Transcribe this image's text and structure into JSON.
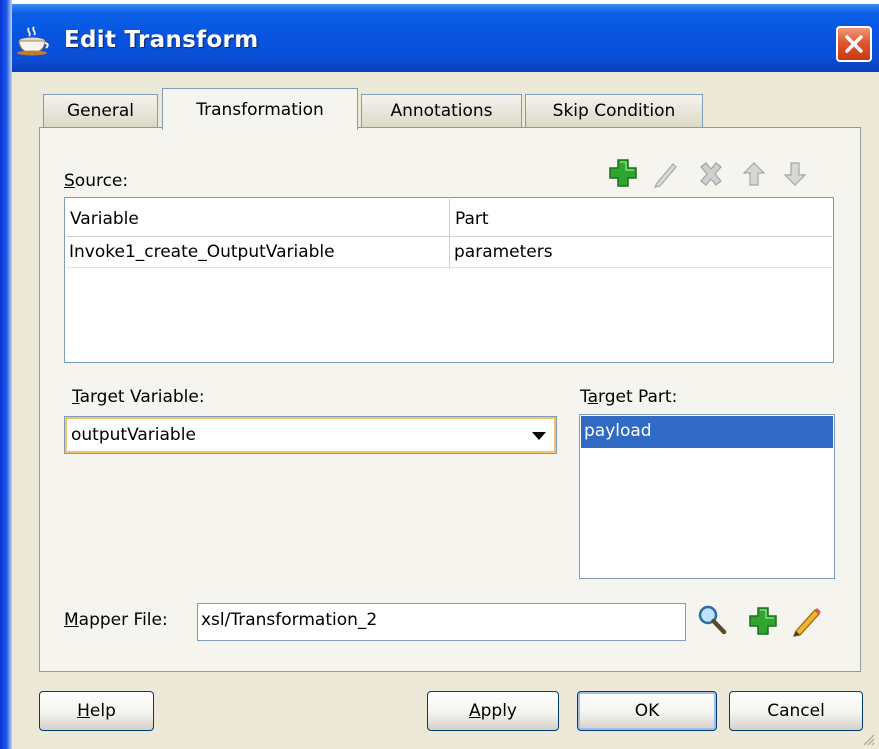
{
  "window": {
    "title": "Edit Transform",
    "icon": "coffee-cup-icon",
    "close_icon": "close-icon"
  },
  "tabs": [
    {
      "label": "General",
      "active": false
    },
    {
      "label": "Transformation",
      "active": true
    },
    {
      "label": "Annotations",
      "active": false
    },
    {
      "label": "Skip Condition",
      "active": false
    }
  ],
  "source": {
    "label_mnemonic": "S",
    "label_rest": "ource:",
    "toolbar": [
      "add-icon",
      "edit-icon",
      "delete-icon",
      "move-up-icon",
      "move-down-icon"
    ],
    "columns": [
      "Variable",
      "Part"
    ],
    "rows": [
      {
        "variable": "Invoke1_create_OutputVariable",
        "part": "parameters"
      }
    ]
  },
  "target_variable": {
    "label_mnemonic": "T",
    "label_rest": "arget Variable:",
    "value": "outputVariable"
  },
  "target_part": {
    "label_pre": "T",
    "label_mnemonic": "a",
    "label_rest": "rget Part:",
    "items": [
      "payload"
    ],
    "selected": "payload"
  },
  "mapper_file": {
    "label_mnemonic": "M",
    "label_rest": "apper File:",
    "value": "xsl/Transformation_2",
    "icons": [
      "search-icon",
      "add-icon",
      "edit-icon"
    ]
  },
  "buttons": {
    "help": {
      "mnemonic": "H",
      "rest": "elp"
    },
    "apply": {
      "mnemonic": "A",
      "rest": "pply"
    },
    "ok": "OK",
    "cancel": "Cancel"
  },
  "colors": {
    "titlebar": "#0754e0",
    "selection": "#316ac5",
    "add_green": "#2fa42f",
    "dialog_bg": "#ece9d8"
  }
}
